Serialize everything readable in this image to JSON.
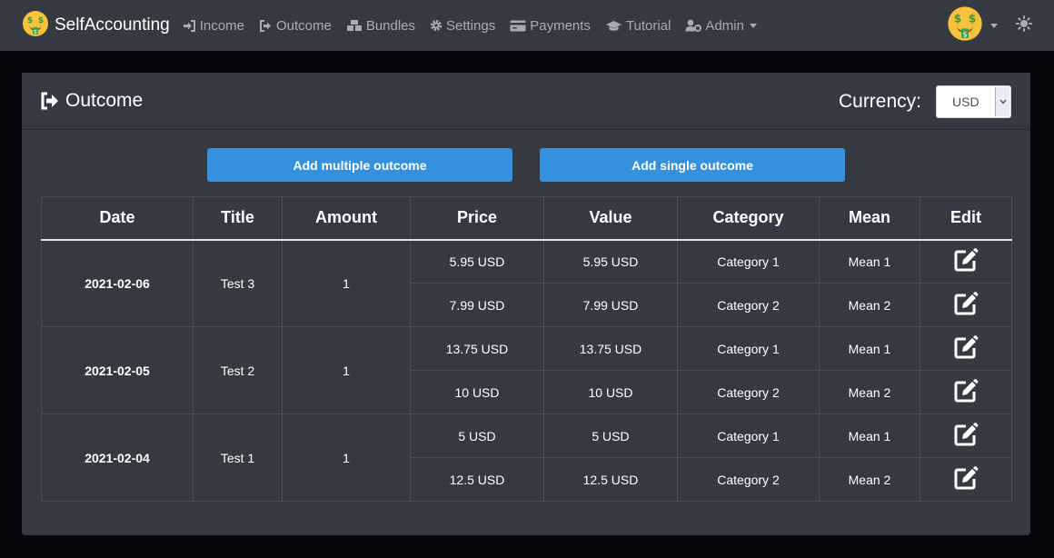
{
  "navbar": {
    "brand": "SelfAccounting",
    "links": [
      {
        "label": "Income",
        "icon": "sign-in-icon"
      },
      {
        "label": "Outcome",
        "icon": "sign-out-icon"
      },
      {
        "label": "Bundles",
        "icon": "boxes-icon"
      },
      {
        "label": "Settings",
        "icon": "gear-icon"
      },
      {
        "label": "Payments",
        "icon": "credit-card-icon"
      },
      {
        "label": "Tutorial",
        "icon": "graduation-cap-icon"
      },
      {
        "label": "Admin",
        "icon": "user-cog-icon"
      }
    ]
  },
  "page": {
    "title": "Outcome",
    "currency_label": "Currency:",
    "currency_value": "USD",
    "add_multiple_label": "Add multiple outcome",
    "add_single_label": "Add single outcome"
  },
  "table": {
    "headers": [
      "Date",
      "Title",
      "Amount",
      "Price",
      "Value",
      "Category",
      "Mean",
      "Edit"
    ],
    "groups": [
      {
        "date": "2021-02-06",
        "title": "Test 3",
        "amount": "1",
        "items": [
          {
            "price": "5.95 USD",
            "value": "5.95 USD",
            "category": "Category 1",
            "mean": "Mean 1"
          },
          {
            "price": "7.99 USD",
            "value": "7.99 USD",
            "category": "Category 2",
            "mean": "Mean 2"
          }
        ]
      },
      {
        "date": "2021-02-05",
        "title": "Test 2",
        "amount": "1",
        "items": [
          {
            "price": "13.75 USD",
            "value": "13.75 USD",
            "category": "Category 1",
            "mean": "Mean 1"
          },
          {
            "price": "10 USD",
            "value": "10 USD",
            "category": "Category 2",
            "mean": "Mean 2"
          }
        ]
      },
      {
        "date": "2021-02-04",
        "title": "Test 1",
        "amount": "1",
        "items": [
          {
            "price": "5 USD",
            "value": "5 USD",
            "category": "Category 1",
            "mean": "Mean 1"
          },
          {
            "price": "12.5 USD",
            "value": "12.5 USD",
            "category": "Category 2",
            "mean": "Mean 2"
          }
        ]
      }
    ]
  },
  "colors": {
    "navbar_bg": "#343a40",
    "page_bg": "#06080b",
    "card_bg": "#343a40",
    "button_bg": "#3591de",
    "nav_link": "#a9adb2"
  }
}
